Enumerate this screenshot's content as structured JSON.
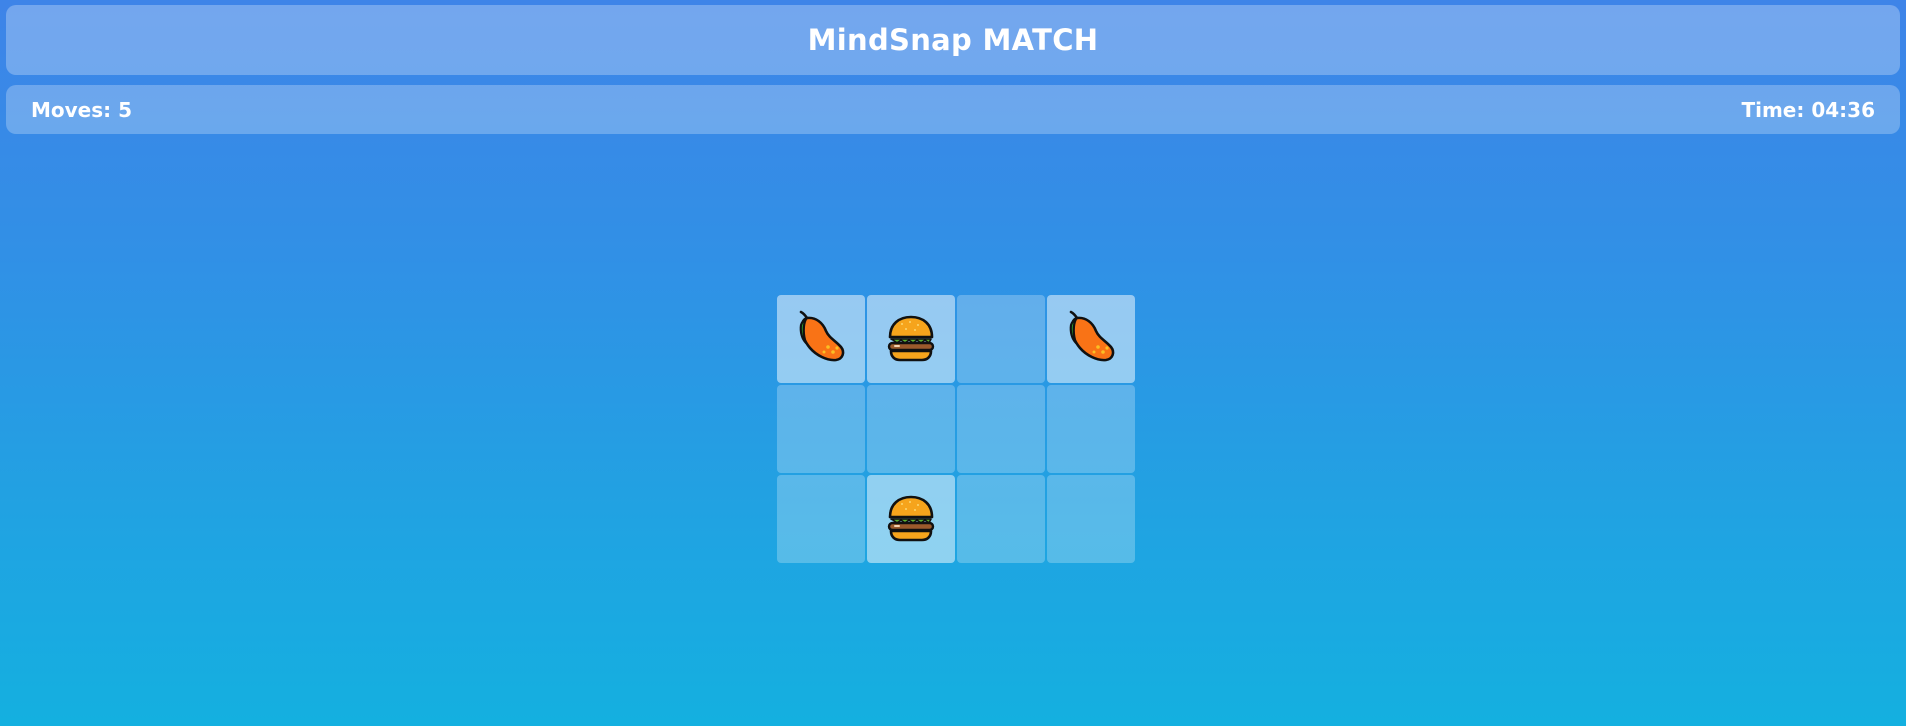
{
  "header": {
    "title": "MindSnap MATCH"
  },
  "status": {
    "moves_label": "Moves:",
    "moves_value": "5",
    "time_label": "Time:",
    "time_value": "04:36"
  },
  "board": {
    "rows": 3,
    "cols": 4,
    "cards": [
      {
        "state": "face-up",
        "icon": "mango-icon"
      },
      {
        "state": "face-up",
        "icon": "hamburger-icon"
      },
      {
        "state": "face-down",
        "icon": ""
      },
      {
        "state": "face-up",
        "icon": "mango-icon"
      },
      {
        "state": "face-down",
        "icon": ""
      },
      {
        "state": "face-down",
        "icon": ""
      },
      {
        "state": "face-down",
        "icon": ""
      },
      {
        "state": "face-down",
        "icon": ""
      },
      {
        "state": "face-down",
        "icon": ""
      },
      {
        "state": "face-up",
        "icon": "hamburger-icon"
      },
      {
        "state": "face-down",
        "icon": ""
      },
      {
        "state": "face-down",
        "icon": ""
      }
    ]
  },
  "colors": {
    "background_top": "#3e84e8",
    "background_bottom": "#14b0e0",
    "text": "#ffffff"
  }
}
